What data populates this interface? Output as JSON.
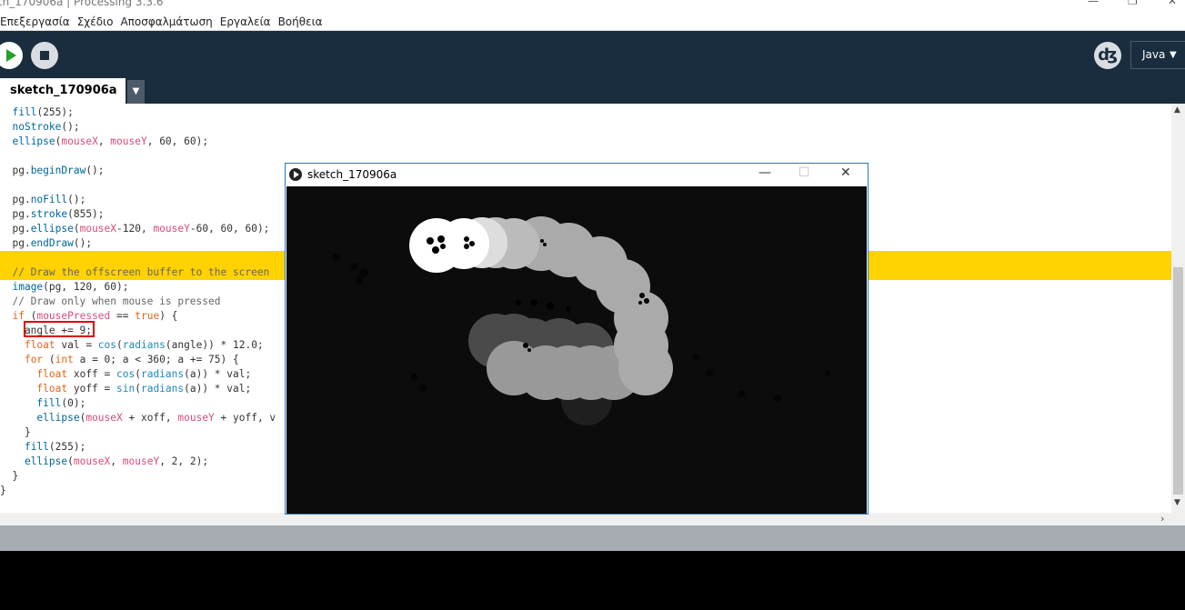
{
  "window": {
    "title": "ch_170906a | Processing 3.3.6"
  },
  "menu": [
    "Επεξεργασία",
    "Σχέδιο",
    "Αποσφαλμάτωση",
    "Εργαλεία",
    "Βοήθεια"
  ],
  "toolbar": {
    "mode_label": "Java",
    "run_icon": "play-icon",
    "stop_icon": "stop-icon",
    "debug_icon": "debugger-icon"
  },
  "tab": {
    "name": "sketch_170906a"
  },
  "code_lines": [
    "  fill(255);",
    "  noStroke();",
    "  ellipse(mouseX, mouseY, 60, 60);",
    "",
    "  pg.beginDraw();",
    "",
    "  pg.noFill();",
    "  pg.stroke(855);",
    "  pg.ellipse(mouseX-120, mouseY-60, 60, 60);",
    "  pg.endDraw();",
    "",
    "  // Draw the offscreen buffer to the screen",
    "  image(pg, 120, 60);",
    "  // Draw only when mouse is pressed",
    "  if (mousePressed == true) {",
    "    angle += 9;",
    "    float val = cos(radians(angle)) * 12.0;",
    "    for (int a = 0; a < 360; a += 75) {",
    "      float xoff = cos(radians(a)) * val;",
    "      float yoff = sin(radians(a)) * val;",
    "      fill(0);",
    "      ellipse(mouseX + xoff, mouseY + yoff, v",
    "    }",
    "    fill(255);",
    "    ellipse(mouseX, mouseY, 2, 2);",
    "  }",
    "}"
  ],
  "sketch_window": {
    "title": "sketch_170906a"
  },
  "colors": {
    "toolbar_bg": "#1a2d3e",
    "highlight": "#ffd200",
    "run_green": "#22a12b",
    "box_red": "#e00000"
  }
}
